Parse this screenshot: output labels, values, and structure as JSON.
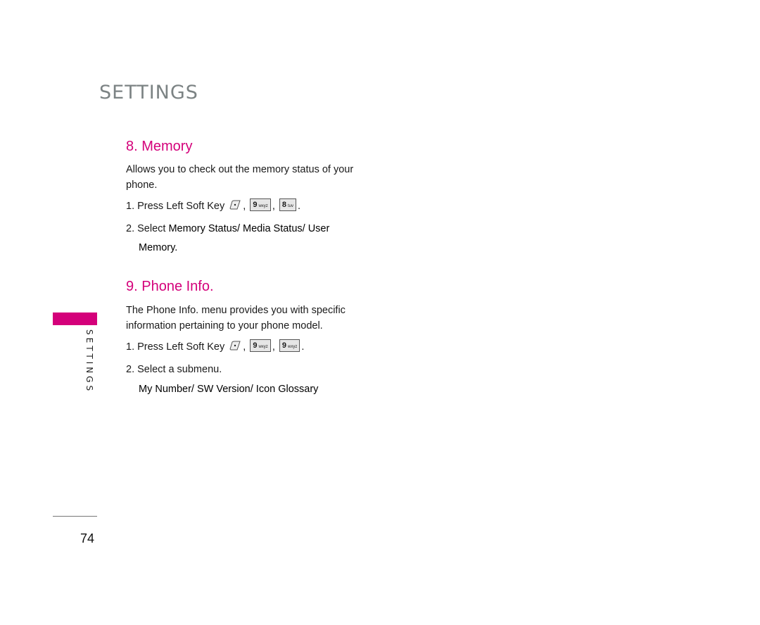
{
  "header": {
    "title": "SETTINGS"
  },
  "sections": [
    {
      "heading": "8. Memory",
      "description": "Allows you to check out the memory status of your phone.",
      "step1": {
        "text": "1. Press Left Soft Key",
        "keys": [
          {
            "digit": "9",
            "letters": "wxyz"
          },
          {
            "digit": "8",
            "letters": "tuv"
          }
        ]
      },
      "step2": {
        "prefix": "2. Select ",
        "bold_line1": "Memory Status/ Media Status/ User",
        "bold_line2": "Memory."
      }
    },
    {
      "heading": "9. Phone Info.",
      "description": "The Phone Info. menu provides you with specific information pertaining to your phone model.",
      "step1": {
        "text": "1. Press Left Soft Key",
        "keys": [
          {
            "digit": "9",
            "letters": "wxyz"
          },
          {
            "digit": "9",
            "letters": "wxyz"
          }
        ]
      },
      "step2": {
        "text": "2. Select a submenu.",
        "submenu": "My Number/ SW Version/ Icon Glossary"
      }
    }
  ],
  "sidebar": {
    "label": "SETTINGS",
    "accent_color": "#d4007a"
  },
  "footer": {
    "page_number": "74"
  },
  "punct": {
    "comma": ",",
    "period": "."
  }
}
